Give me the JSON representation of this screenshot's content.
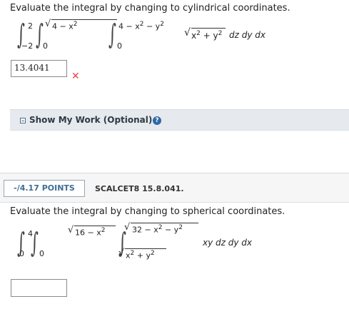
{
  "question1": {
    "prompt": "Evaluate the integral by changing to cylindrical coordinates.",
    "outer_upper": "2",
    "outer_lower": "−2",
    "middle_upper_radicand": "4 − x",
    "middle_upper_exp": "2",
    "middle_lower": "0",
    "inner_upper_prefix": "4 − x",
    "inner_upper_exp1": "2",
    "inner_upper_mid": " − y",
    "inner_upper_exp2": "2",
    "inner_lower": "0",
    "integrand_radicand_a": "x",
    "integrand_exp_a": "2",
    "integrand_plus": " + y",
    "integrand_exp_b": "2",
    "differentials": "dz dy dx",
    "answer_value": "13.4041",
    "answer_status": "incorrect",
    "x_mark": "✕"
  },
  "show_work": {
    "label": "Show My Work (Optional)",
    "help_glyph": "?"
  },
  "question2_header": {
    "points": "-/4.17 POINTS",
    "problem_id": "SCALCET8 15.8.041."
  },
  "question2": {
    "prompt": "Evaluate the integral by changing to spherical coordinates.",
    "outer_upper": "4",
    "outer_lower": "0",
    "middle_upper_radicand": "16 − x",
    "middle_upper_exp": "2",
    "middle_lower": "0",
    "inner_upper_radicand": "32 − x",
    "inner_upper_exp1": "2",
    "inner_upper_mid": " − y",
    "inner_upper_exp2": "2",
    "inner_lower_radicand": "x",
    "inner_lower_exp1": "2",
    "inner_lower_mid": " + y",
    "inner_lower_exp2": "2",
    "integrand": "xy dz dy dx",
    "answer_value": ""
  },
  "colors": {
    "incorrect": "#e0454a",
    "points_text": "#3f6d95",
    "help_icon": "#2f6aa8",
    "show_work_bg": "#e6eaee"
  }
}
